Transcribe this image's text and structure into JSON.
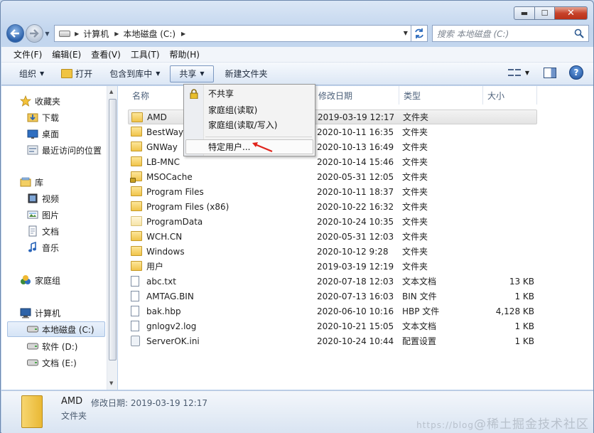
{
  "window": {
    "caption_min": "▬",
    "caption_max": "☐",
    "caption_close": "✕"
  },
  "address": {
    "segments": [
      "计算机",
      "本地磁盘 (C:)"
    ],
    "search_placeholder": "搜索 本地磁盘 (C:)"
  },
  "menubar": [
    "文件(F)",
    "编辑(E)",
    "查看(V)",
    "工具(T)",
    "帮助(H)"
  ],
  "toolbar": {
    "organize": "组织",
    "open": "打开",
    "include": "包含到库中",
    "share": "共享",
    "new_folder": "新建文件夹"
  },
  "share_menu": [
    "不共享",
    "家庭组(读取)",
    "家庭组(读取/写入)",
    "特定用户..."
  ],
  "nav": {
    "favorites": "收藏夹",
    "downloads": "下载",
    "desktop": "桌面",
    "recent": "最近访问的位置",
    "libraries": "库",
    "videos": "视频",
    "pictures": "图片",
    "documents": "文档",
    "music": "音乐",
    "homegroup": "家庭组",
    "computer": "计算机",
    "drive_c": "本地磁盘 (C:)",
    "drive_d": "软件 (D:)",
    "drive_e": "文档 (E:)"
  },
  "columns": {
    "name": "名称",
    "date": "修改日期",
    "type": "类型",
    "size": "大小"
  },
  "files": [
    {
      "name": "AMD",
      "date": "2019-03-19 12:17",
      "type": "文件夹",
      "size": "",
      "icon": "folder"
    },
    {
      "name": "BestWay",
      "date": "2020-10-11 16:35",
      "type": "文件夹",
      "size": "",
      "icon": "folder"
    },
    {
      "name": "GNWay",
      "date": "2020-10-13 16:49",
      "type": "文件夹",
      "size": "",
      "icon": "folder"
    },
    {
      "name": "LB-MNC",
      "date": "2020-10-14 15:46",
      "type": "文件夹",
      "size": "",
      "icon": "folder"
    },
    {
      "name": "MSOCache",
      "date": "2020-05-31 12:05",
      "type": "文件夹",
      "size": "",
      "icon": "locked-folder"
    },
    {
      "name": "Program Files",
      "date": "2020-10-11 18:37",
      "type": "文件夹",
      "size": "",
      "icon": "folder"
    },
    {
      "name": "Program Files (x86)",
      "date": "2020-10-22 16:32",
      "type": "文件夹",
      "size": "",
      "icon": "folder"
    },
    {
      "name": "ProgramData",
      "date": "2020-10-24 10:35",
      "type": "文件夹",
      "size": "",
      "icon": "hidden-folder"
    },
    {
      "name": "WCH.CN",
      "date": "2020-05-31 12:03",
      "type": "文件夹",
      "size": "",
      "icon": "folder"
    },
    {
      "name": "Windows",
      "date": "2020-10-12 9:28",
      "type": "文件夹",
      "size": "",
      "icon": "folder"
    },
    {
      "name": "用户",
      "date": "2019-03-19 12:19",
      "type": "文件夹",
      "size": "",
      "icon": "folder"
    },
    {
      "name": "abc.txt",
      "date": "2020-07-18 12:03",
      "type": "文本文档",
      "size": "13 KB",
      "icon": "text-file"
    },
    {
      "name": "AMTAG.BIN",
      "date": "2020-07-13 16:03",
      "type": "BIN 文件",
      "size": "1 KB",
      "icon": "file"
    },
    {
      "name": "bak.hbp",
      "date": "2020-06-10 10:16",
      "type": "HBP 文件",
      "size": "4,128 KB",
      "icon": "file"
    },
    {
      "name": "gnlogv2.log",
      "date": "2020-10-21 15:05",
      "type": "文本文档",
      "size": "1 KB",
      "icon": "text-file"
    },
    {
      "name": "ServerOK.ini",
      "date": "2020-10-24 10:44",
      "type": "配置设置",
      "size": "1 KB",
      "icon": "ini-file"
    }
  ],
  "details": {
    "name": "AMD",
    "meta_label": "修改日期:",
    "meta_value": "2019-03-19 12:17",
    "type": "文件夹"
  },
  "watermark": {
    "small": "https://blog",
    "big": "@稀土掘金技术社区"
  }
}
